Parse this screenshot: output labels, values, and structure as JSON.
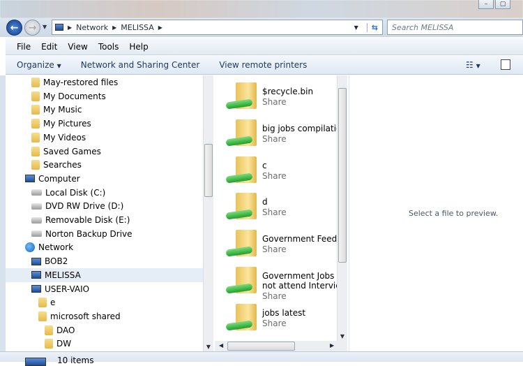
{
  "window": {
    "minimize_icon": "minimize-icon",
    "maximize_icon": "maximize-icon"
  },
  "address": {
    "segments": [
      "Network",
      "MELISSA"
    ],
    "search_placeholder": "Search MELISSA"
  },
  "menu": [
    "File",
    "Edit",
    "View",
    "Tools",
    "Help"
  ],
  "toolbar": {
    "organize": "Organize",
    "network_sharing": "Network and Sharing Center",
    "remote_printers": "View remote printers"
  },
  "nav": [
    {
      "label": "May-restored files",
      "icon": "folder",
      "level": 2
    },
    {
      "label": "My Documents",
      "icon": "folder",
      "level": 2
    },
    {
      "label": "My Music",
      "icon": "folder",
      "level": 2
    },
    {
      "label": "My Pictures",
      "icon": "folder",
      "level": 2
    },
    {
      "label": "My Videos",
      "icon": "folder",
      "level": 2
    },
    {
      "label": "Saved Games",
      "icon": "folder",
      "level": 2
    },
    {
      "label": "Searches",
      "icon": "folder",
      "level": 2
    },
    {
      "label": "Computer",
      "icon": "pc",
      "level": 1
    },
    {
      "label": "Local Disk (C:)",
      "icon": "drive",
      "level": 2
    },
    {
      "label": "DVD RW Drive (D:)",
      "icon": "drive",
      "level": 2
    },
    {
      "label": "Removable Disk (E:)",
      "icon": "drive",
      "level": 2
    },
    {
      "label": "Norton Backup Drive",
      "icon": "drive",
      "level": 2
    },
    {
      "label": "Network",
      "icon": "globe",
      "level": 1
    },
    {
      "label": "BOB2",
      "icon": "pc",
      "level": 2
    },
    {
      "label": "MELISSA",
      "icon": "pc",
      "level": 2,
      "selected": true
    },
    {
      "label": "USER-VAIO",
      "icon": "pc",
      "level": 2
    },
    {
      "label": "e",
      "icon": "folder",
      "level": 3
    },
    {
      "label": "microsoft shared",
      "icon": "folder",
      "level": 3
    },
    {
      "label": "DAO",
      "icon": "folder",
      "level": 4
    },
    {
      "label": "DW",
      "icon": "folder",
      "level": 4
    }
  ],
  "files": [
    {
      "name": "$recycle.bin",
      "sub": "Share"
    },
    {
      "name": "big jobs compilation",
      "sub": "Share"
    },
    {
      "name": "c",
      "sub": "Share"
    },
    {
      "name": "d",
      "sub": "Share"
    },
    {
      "name": "Government Feedbac",
      "sub": "Share"
    },
    {
      "name": "Government Jobs Inte",
      "name2": "not attend Interview",
      "sub": "Share"
    },
    {
      "name": "jobs latest",
      "sub": "Share"
    }
  ],
  "preview": {
    "message": "Select a file to preview."
  },
  "status": {
    "count": "10 items"
  }
}
